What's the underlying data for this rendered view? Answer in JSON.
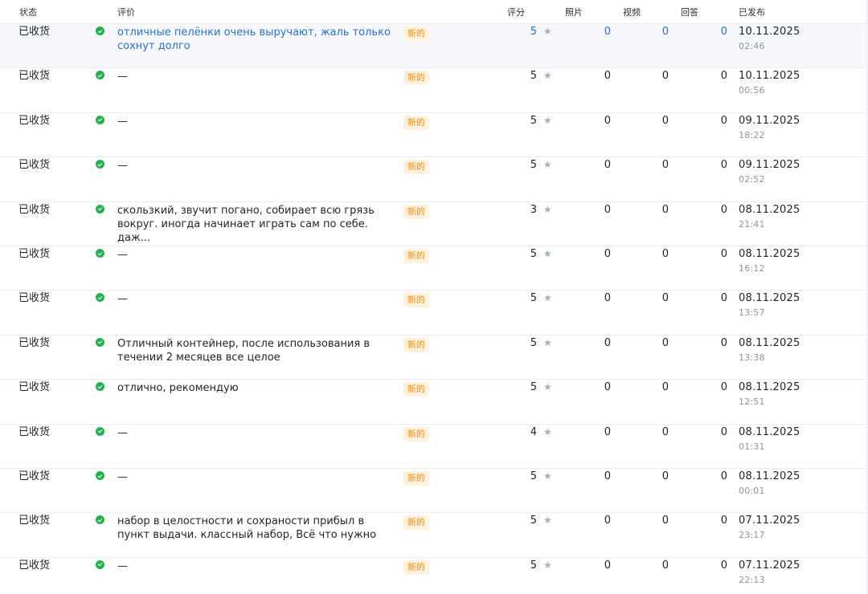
{
  "columns": {
    "status": "状态",
    "comment": "评价",
    "rating": "评分",
    "photos": "照片",
    "videos": "视频",
    "answers": "回答",
    "published": "已发布"
  },
  "star_icon": "star-icon",
  "reviews": [
    {
      "status": "已收货",
      "comment": "отличные пелёнки очень выручают, жаль только сохнут долго",
      "badge": "新的",
      "rating": "5",
      "photos": "0",
      "videos": "0",
      "answers": "0",
      "date": "10.11.2025",
      "time": "02:46",
      "highlighted": true
    },
    {
      "status": "已收货",
      "comment": "—",
      "badge": "新的",
      "rating": "5",
      "photos": "0",
      "videos": "0",
      "answers": "0",
      "date": "10.11.2025",
      "time": "00:56"
    },
    {
      "status": "已收货",
      "comment": "—",
      "badge": "新的",
      "rating": "5",
      "photos": "0",
      "videos": "0",
      "answers": "0",
      "date": "09.11.2025",
      "time": "18:22"
    },
    {
      "status": "已收货",
      "comment": "—",
      "badge": "新的",
      "rating": "5",
      "photos": "0",
      "videos": "0",
      "answers": "0",
      "date": "09.11.2025",
      "time": "02:52"
    },
    {
      "status": "已收货",
      "comment": "скользкий, звучит погано, собирает всю грязь вокруг. иногда начинает играть сам по себе. даж...",
      "badge": "新的",
      "rating": "3",
      "photos": "0",
      "videos": "0",
      "answers": "0",
      "date": "08.11.2025",
      "time": "21:41"
    },
    {
      "status": "已收货",
      "comment": "—",
      "badge": "新的",
      "rating": "5",
      "photos": "0",
      "videos": "0",
      "answers": "0",
      "date": "08.11.2025",
      "time": "16:12"
    },
    {
      "status": "已收货",
      "comment": "—",
      "badge": "新的",
      "rating": "5",
      "photos": "0",
      "videos": "0",
      "answers": "0",
      "date": "08.11.2025",
      "time": "13:57"
    },
    {
      "status": "已收货",
      "comment": "Отличный контейнер, после использования в течении 2 месяцев все целое",
      "badge": "新的",
      "rating": "5",
      "photos": "0",
      "videos": "0",
      "answers": "0",
      "date": "08.11.2025",
      "time": "13:38"
    },
    {
      "status": "已收货",
      "comment": "отлично, рекомендую",
      "badge": "新的",
      "rating": "5",
      "photos": "0",
      "videos": "0",
      "answers": "0",
      "date": "08.11.2025",
      "time": "12:51"
    },
    {
      "status": "已收货",
      "comment": "—",
      "badge": "新的",
      "rating": "4",
      "photos": "0",
      "videos": "0",
      "answers": "0",
      "date": "08.11.2025",
      "time": "01:31"
    },
    {
      "status": "已收货",
      "comment": "—",
      "badge": "新的",
      "rating": "5",
      "photos": "0",
      "videos": "0",
      "answers": "0",
      "date": "08.11.2025",
      "time": "00:01"
    },
    {
      "status": "已收货",
      "comment": "набор в целостности и сохраности прибыл в пункт выдачи. классный набор, Всё что нужно",
      "badge": "新的",
      "rating": "5",
      "photos": "0",
      "videos": "0",
      "answers": "0",
      "date": "07.11.2025",
      "time": "23:17"
    },
    {
      "status": "已收货",
      "comment": "—",
      "badge": "新的",
      "rating": "5",
      "photos": "0",
      "videos": "0",
      "answers": "0",
      "date": "07.11.2025",
      "time": "22:13"
    }
  ]
}
